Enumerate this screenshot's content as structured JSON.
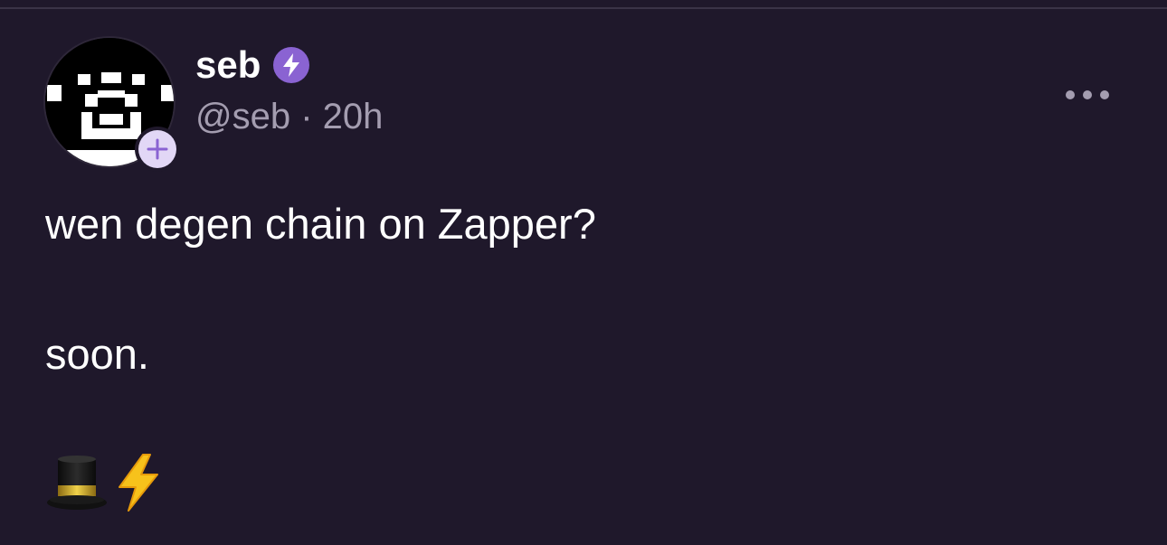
{
  "post": {
    "author": {
      "display_name": "seb",
      "username": "@seb",
      "badge_icon": "power-badge-icon",
      "badge_color": "#8a63d2"
    },
    "separator": "·",
    "timestamp": "20h",
    "lines": [
      "wen degen chain on Zapper?",
      "soon."
    ],
    "emojis": [
      "top-hat-icon",
      "lightning-icon"
    ],
    "more_icon": "more-horizontal-icon"
  },
  "colors": {
    "background": "#1f182b",
    "text_primary": "#ffffff",
    "text_secondary": "#a49db0",
    "follow_badge": "#e2d7f6",
    "accent": "#8a63d2"
  }
}
